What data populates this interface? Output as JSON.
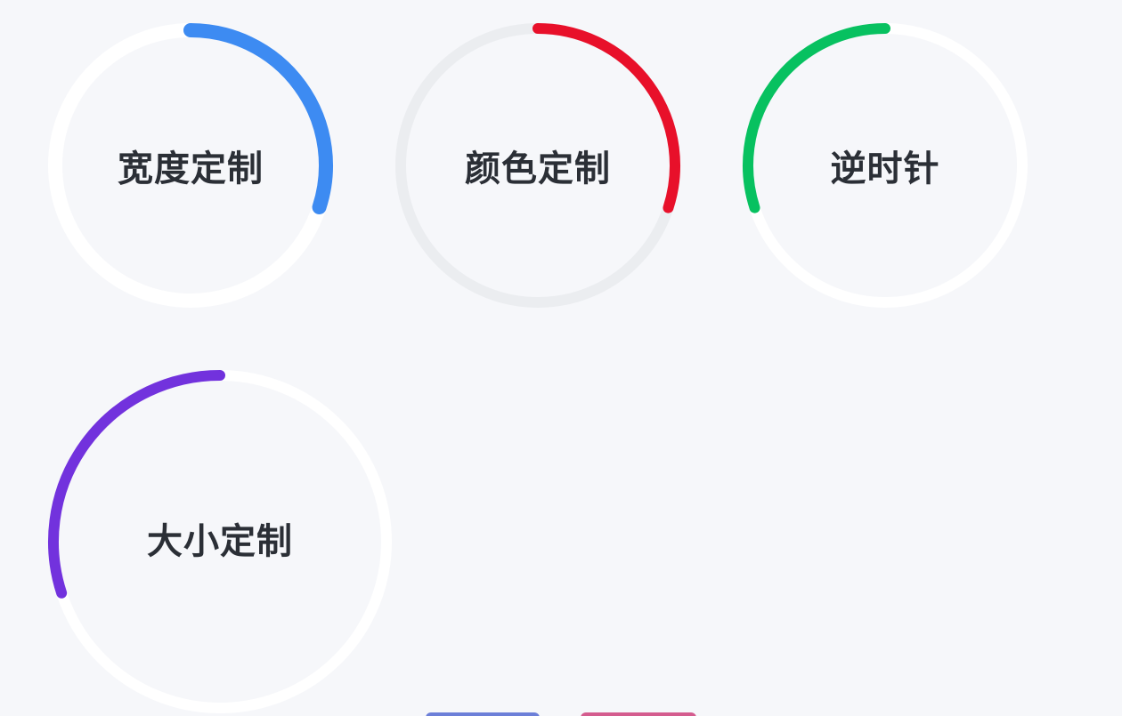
{
  "circles": [
    {
      "id": "c-width",
      "label": "宽度定制",
      "progress": 0.3,
      "counterclockwise": false,
      "track_color": "#ffffff",
      "bar_color": "#3d8bf2",
      "track_width": 16,
      "bar_width": 16
    },
    {
      "id": "c-color",
      "label": "颜色定制",
      "progress": 0.3,
      "counterclockwise": false,
      "track_color": "#ebedf0",
      "bar_color": "#e8102a",
      "track_width": 12,
      "bar_width": 12
    },
    {
      "id": "c-ccw",
      "label": "逆时针",
      "progress": 0.3,
      "counterclockwise": true,
      "track_color": "#ffffff",
      "bar_color": "#07c160",
      "track_width": 12,
      "bar_width": 12
    },
    {
      "id": "c-size",
      "label": "大小定制",
      "progress": 0.3,
      "counterclockwise": true,
      "track_color": "#ffffff",
      "bar_color": "#7232dd",
      "track_width": 12,
      "bar_width": 12
    }
  ]
}
